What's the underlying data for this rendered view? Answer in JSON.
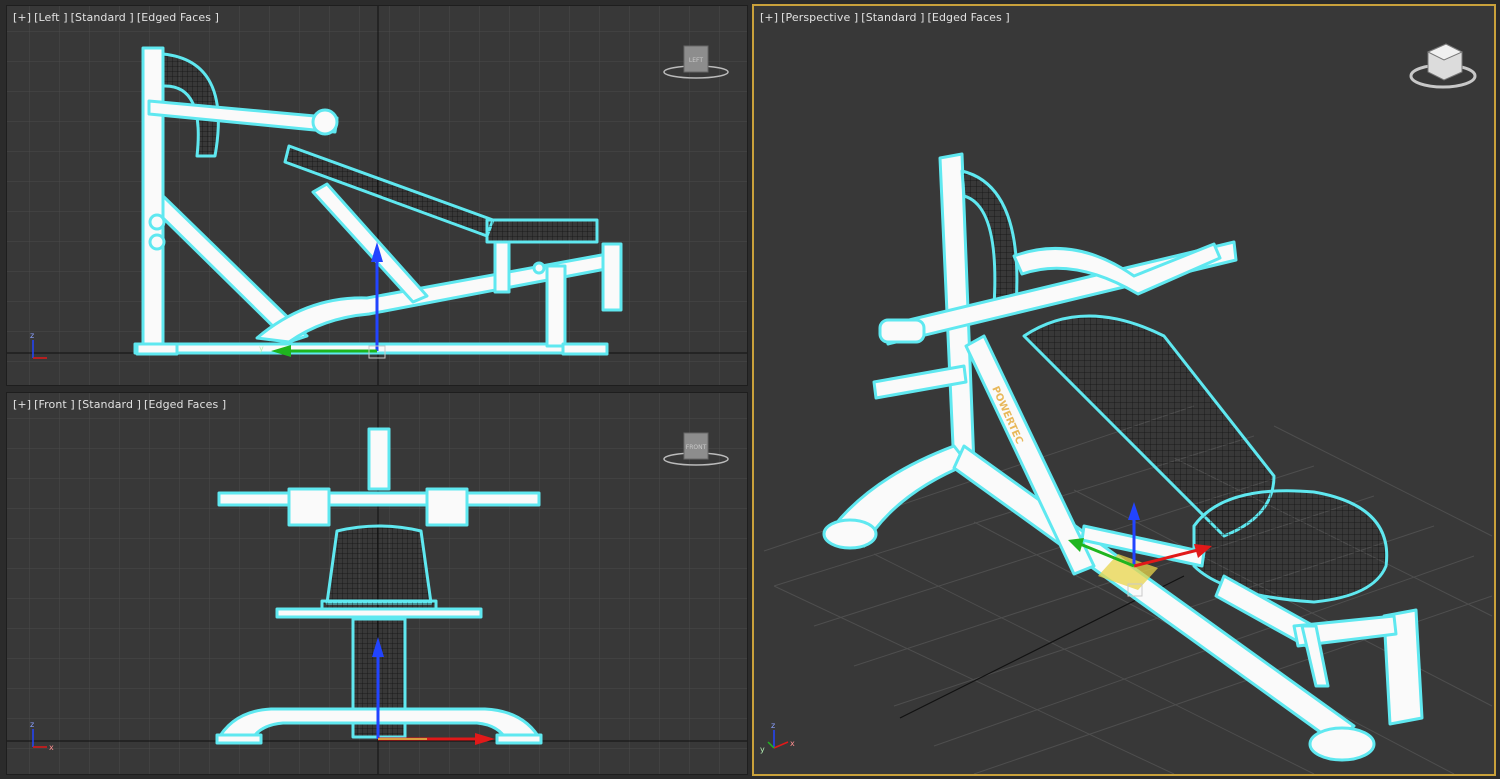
{
  "viewports": {
    "left": {
      "labels": [
        "[+]",
        "[Left ]",
        "[Standard ]",
        "[Edged Faces ]"
      ],
      "cube_label": "LEFT"
    },
    "front": {
      "labels": [
        "[+]",
        "[Front ]",
        "[Standard ]",
        "[Edged Faces ]"
      ],
      "cube_label": "FRONT"
    },
    "perspective": {
      "labels": [
        "[+]",
        "[Perspective ]",
        "[Standard ]",
        "[Edged Faces ]"
      ],
      "cube_label": "",
      "active": true
    }
  },
  "model": {
    "brand_text": "POWERTEC"
  },
  "axes": {
    "x": "x",
    "y": "y",
    "z": "z"
  },
  "colors": {
    "viewport_bg": "#383838",
    "grid": "#4a4a4a",
    "selection_outline": "#5fe8f0",
    "active_border": "#c9a13b",
    "axis_x": "#e11919",
    "axis_y": "#1fb51f",
    "axis_z": "#2244ff"
  }
}
